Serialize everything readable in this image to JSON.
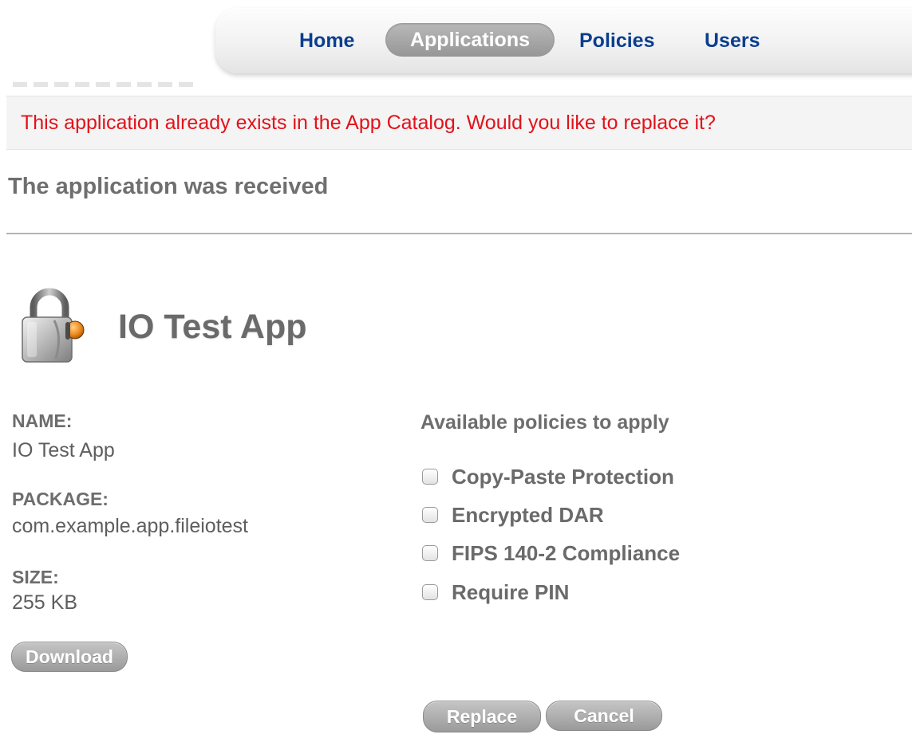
{
  "nav": {
    "items": [
      "Home",
      "Applications",
      "Policies",
      "Users"
    ],
    "active": "Applications"
  },
  "alert": {
    "message": "This application already exists in the App Catalog. Would you like to replace it?",
    "color": "#e2121a"
  },
  "status": {
    "heading": "The application was received"
  },
  "app": {
    "icon": "lock-app-icon",
    "title": "IO Test App",
    "name_label": "NAME:",
    "name_value": "IO Test App",
    "package_label": "PACKAGE:",
    "package_value": "com.example.app.fileiotest",
    "size_label": "SIZE:",
    "size_value": "255 KB",
    "download_label": "Download"
  },
  "policies": {
    "heading": "Available policies to apply",
    "items": [
      {
        "label": "Copy-Paste Protection",
        "checked": false
      },
      {
        "label": "Encrypted DAR",
        "checked": false
      },
      {
        "label": "FIPS 140-2 Compliance",
        "checked": false
      },
      {
        "label": "Require PIN",
        "checked": false
      }
    ]
  },
  "actions": {
    "replace_label": "Replace",
    "cancel_label": "Cancel"
  },
  "colors": {
    "nav_link": "#0b3e8e",
    "nav_active_bg": "#a8a8a8",
    "button_bg": "#b0b0b0",
    "text_gray": "#6a6a6a"
  }
}
